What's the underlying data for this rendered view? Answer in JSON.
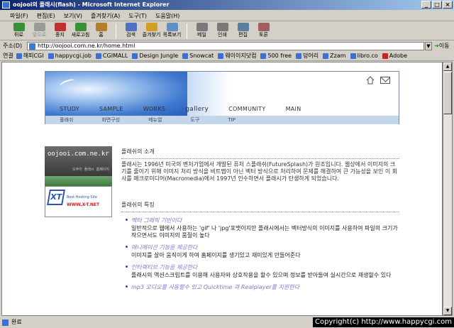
{
  "window": {
    "title": "oojooi의 플래시(flash) - Microsoft Internet Explorer"
  },
  "menubar": [
    "파일(F)",
    "편집(E)",
    "보기(V)",
    "즐겨찾기(A)",
    "도구(T)",
    "도움말(H)"
  ],
  "toolbar": [
    {
      "label": "뒤로",
      "icon": "back-icon",
      "color": "#3a8f3a",
      "disabled": false
    },
    {
      "label": "앞으로",
      "icon": "forward-icon",
      "color": "#9a9a9a",
      "disabled": true
    },
    {
      "label": "중지",
      "icon": "stop-icon",
      "color": "#c03030",
      "disabled": false
    },
    {
      "label": "새로고침",
      "icon": "refresh-icon",
      "color": "#3a8f3a",
      "disabled": false
    },
    {
      "label": "홈",
      "icon": "home-icon",
      "color": "#b08030",
      "disabled": false
    },
    {
      "label": "검색",
      "icon": "search-icon",
      "color": "#5070c0",
      "disabled": false
    },
    {
      "label": "즐겨찾기",
      "icon": "favorites-icon",
      "color": "#d0a020",
      "disabled": false
    },
    {
      "label": "목록보기",
      "icon": "history-icon",
      "color": "#6090c0",
      "disabled": false
    },
    {
      "label": "메일",
      "icon": "mail-icon",
      "color": "#7a7a7a",
      "disabled": false
    },
    {
      "label": "인쇄",
      "icon": "print-icon",
      "color": "#7a7a7a",
      "disabled": false
    },
    {
      "label": "편집",
      "icon": "edit-icon",
      "color": "#5a7fa0",
      "disabled": false
    },
    {
      "label": "토론",
      "icon": "discuss-icon",
      "color": "#a06060",
      "disabled": false
    }
  ],
  "address": {
    "label": "주소(D)",
    "url": "http://oojooi.com.ne.kr/home.html",
    "go": "이동"
  },
  "links": {
    "label": "연결",
    "items": [
      "해피CGI",
      "happycgi.job",
      "CGIMALL",
      "Design Jungle",
      "Snowcat",
      "웨이이지닷컴",
      "500 free",
      "덩어리",
      "Zzam",
      "libro.co",
      "Adobe"
    ]
  },
  "site": {
    "mainnav": [
      "STUDY",
      "SAMPLE",
      "WORKS",
      "gallery",
      "COMMUNITY",
      "MAIN"
    ],
    "subnav": [
      "플래쉬",
      "화면구성",
      "메뉴얼",
      "도구",
      "TIP"
    ],
    "side": {
      "logo": "oojooi.com.ne.kr",
      "logo_sub": "오주이 플래시 홈페이지",
      "xt_mark": "XT",
      "xt_line1": "Best Hosting Site",
      "xt_line2": "WWW.X-T.NET"
    },
    "intro_title": "플래쉬의 소개",
    "intro_text": "플래시는 1996년 미국의 벤처기업에서 개발된 퓨처 스플래쉬(FutureSplash)가 원조입니다. 웹상에서 이미지의 크기를 줄이기 위해 이미지 처리 방식을 비트맵이 아닌 벡터 방식으로 처리하여 문제를 해결하여 큰 가능성을 보인 이 회사를 매크로미디어(Macromedia)에서 1997년 인수하면서 플래시가 탄생하게 되었습니다.",
    "features_title": "플래쉬의 특징",
    "features": [
      {
        "title": "벡터 그래픽 기반이다",
        "desc": "일반적으로 웹에서 사용하는 'gif' 나 'jpg'포맷이지만 플래시에서는 벡터방식의 이미지를 사용하여 파일의 크기가 작으면서도 이미지의 품질이 높다"
      },
      {
        "title": "애니메이션 기능을 제공한다",
        "desc": "이미지를 살아 움직이게 하여 홈페이지를 생기있고 재미있게 만들어준다"
      },
      {
        "title": "인터랙티브 기능을 제공한다",
        "desc": "플래시의 액션스크립트를 이용해 사용자와 상호작용을 할수 있으며 정보를 받아들여 실시간으로 재생할수 있다"
      },
      {
        "title": "mp3 오디오를 사용할수 있고 Quicktime 과 Realplayer를 지원한다",
        "desc": ""
      }
    ]
  },
  "status": {
    "text": "완료",
    "copyright": "Copyright(c) http://www.happycgi.com"
  }
}
